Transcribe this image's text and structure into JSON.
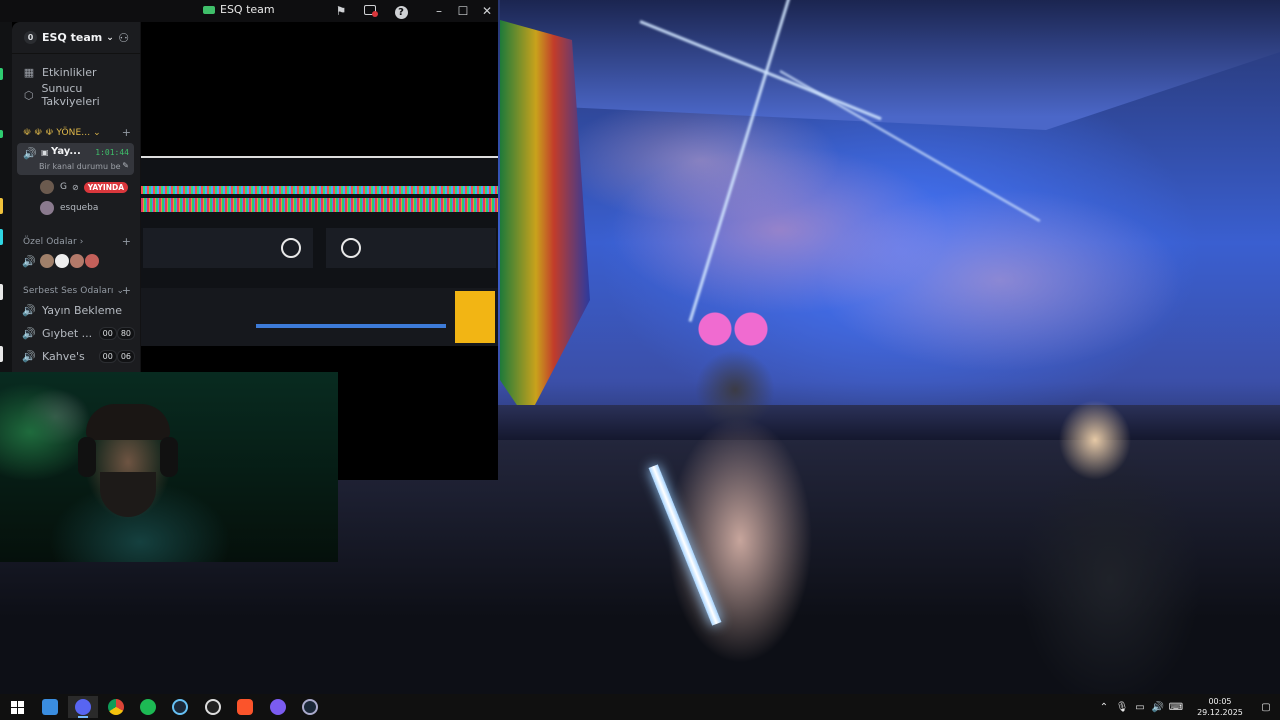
{
  "window": {
    "title": "ESQ team"
  },
  "server": {
    "name": "ESQ team",
    "badge": "0"
  },
  "menu": {
    "events": "Etkinlikler",
    "boosts": "Sunucu Takviyeleri"
  },
  "categories": {
    "admin": "☫ ☫ ☫ YÖNE...",
    "private": "Özel Odalar",
    "free_voice": "Serbest Ses Odaları"
  },
  "live_channel": {
    "name": "Yay...",
    "timer": "1:01:44",
    "status": "Bir kanal durumu bel..."
  },
  "members": [
    {
      "name": "G",
      "badge": "YAYINDA"
    },
    {
      "name": "esqueba"
    }
  ],
  "voice_channels": [
    {
      "name": "Yayın Bekleme"
    },
    {
      "name": "Gıybet ...",
      "count_a": "00",
      "count_b": "80"
    },
    {
      "name": "Kahve's",
      "count_a": "00",
      "count_b": "06"
    }
  ],
  "taskbar": {
    "apps": [
      "start-icon",
      "file-explorer-icon",
      "discord-icon",
      "chrome-icon",
      "spotify-icon",
      "steam-icon",
      "obs-icon",
      "brave-icon",
      "app-icon",
      "steam-icon-2"
    ],
    "time": "00:05",
    "date": "29.12.2025"
  },
  "colors": {
    "discord_bg": "#1b1c1f",
    "live_red": "#da373c",
    "accent_green": "#3fbf6a"
  }
}
